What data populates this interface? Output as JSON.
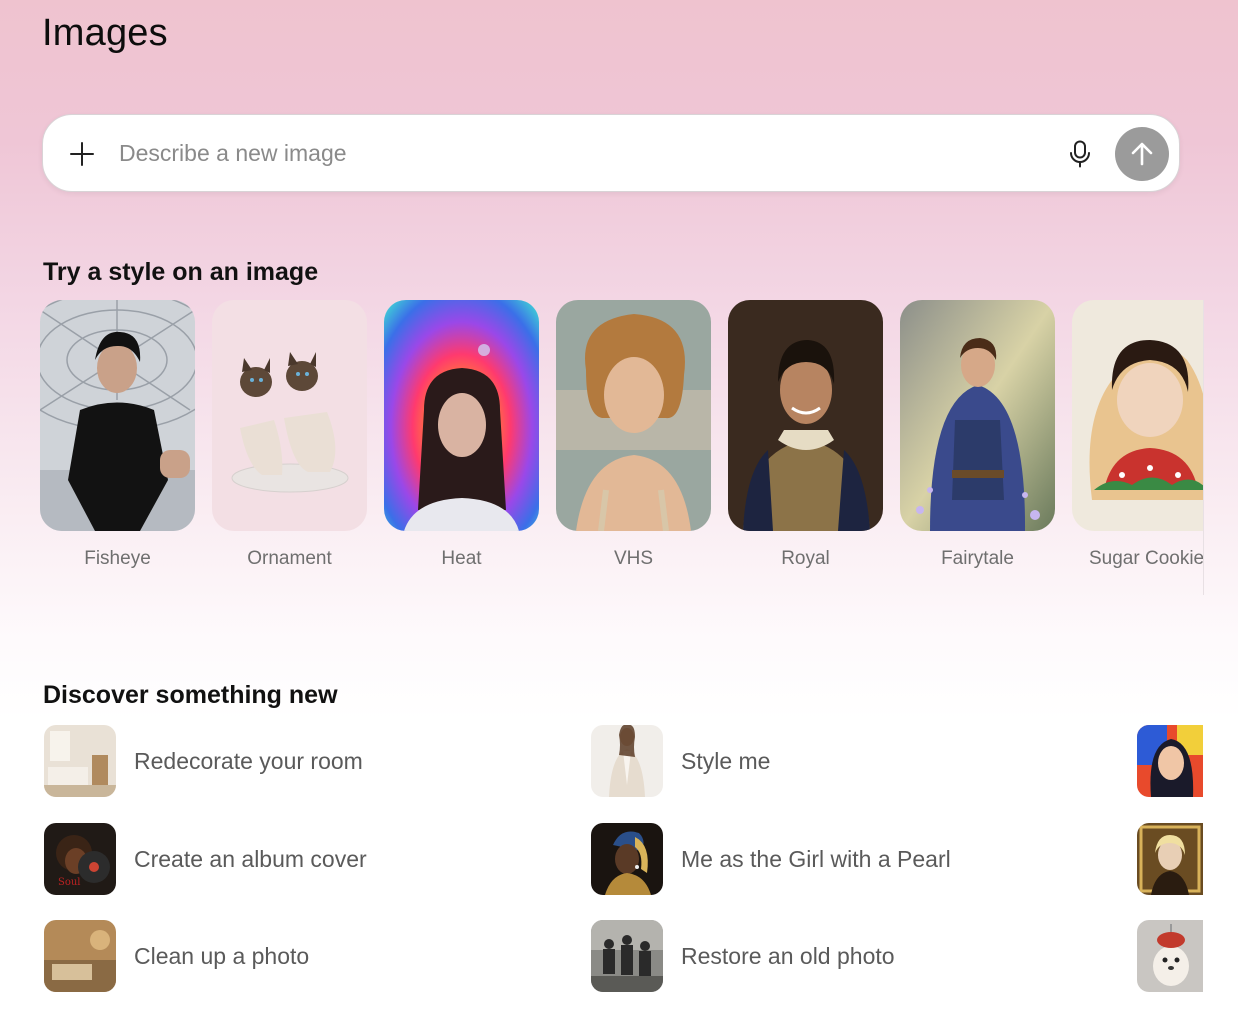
{
  "page": {
    "title": "Images"
  },
  "prompt": {
    "placeholder": "Describe a new image"
  },
  "styles_section": {
    "title": "Try a style on an image",
    "items": [
      {
        "label": "Fisheye"
      },
      {
        "label": "Ornament"
      },
      {
        "label": "Heat"
      },
      {
        "label": "VHS"
      },
      {
        "label": "Royal"
      },
      {
        "label": "Fairytale"
      },
      {
        "label": "Sugar Cookie"
      }
    ]
  },
  "discover_section": {
    "title": "Discover something new",
    "left": [
      {
        "label": "Redecorate your room"
      },
      {
        "label": "Create an album cover"
      },
      {
        "label": "Clean up a photo"
      }
    ],
    "middle": [
      {
        "label": "Style me"
      },
      {
        "label": "Me as the Girl with a Pearl"
      },
      {
        "label": "Restore an old photo"
      }
    ]
  },
  "colors": {
    "accent_send": "#9b9b9b",
    "label_gray": "#6f6f6f"
  }
}
